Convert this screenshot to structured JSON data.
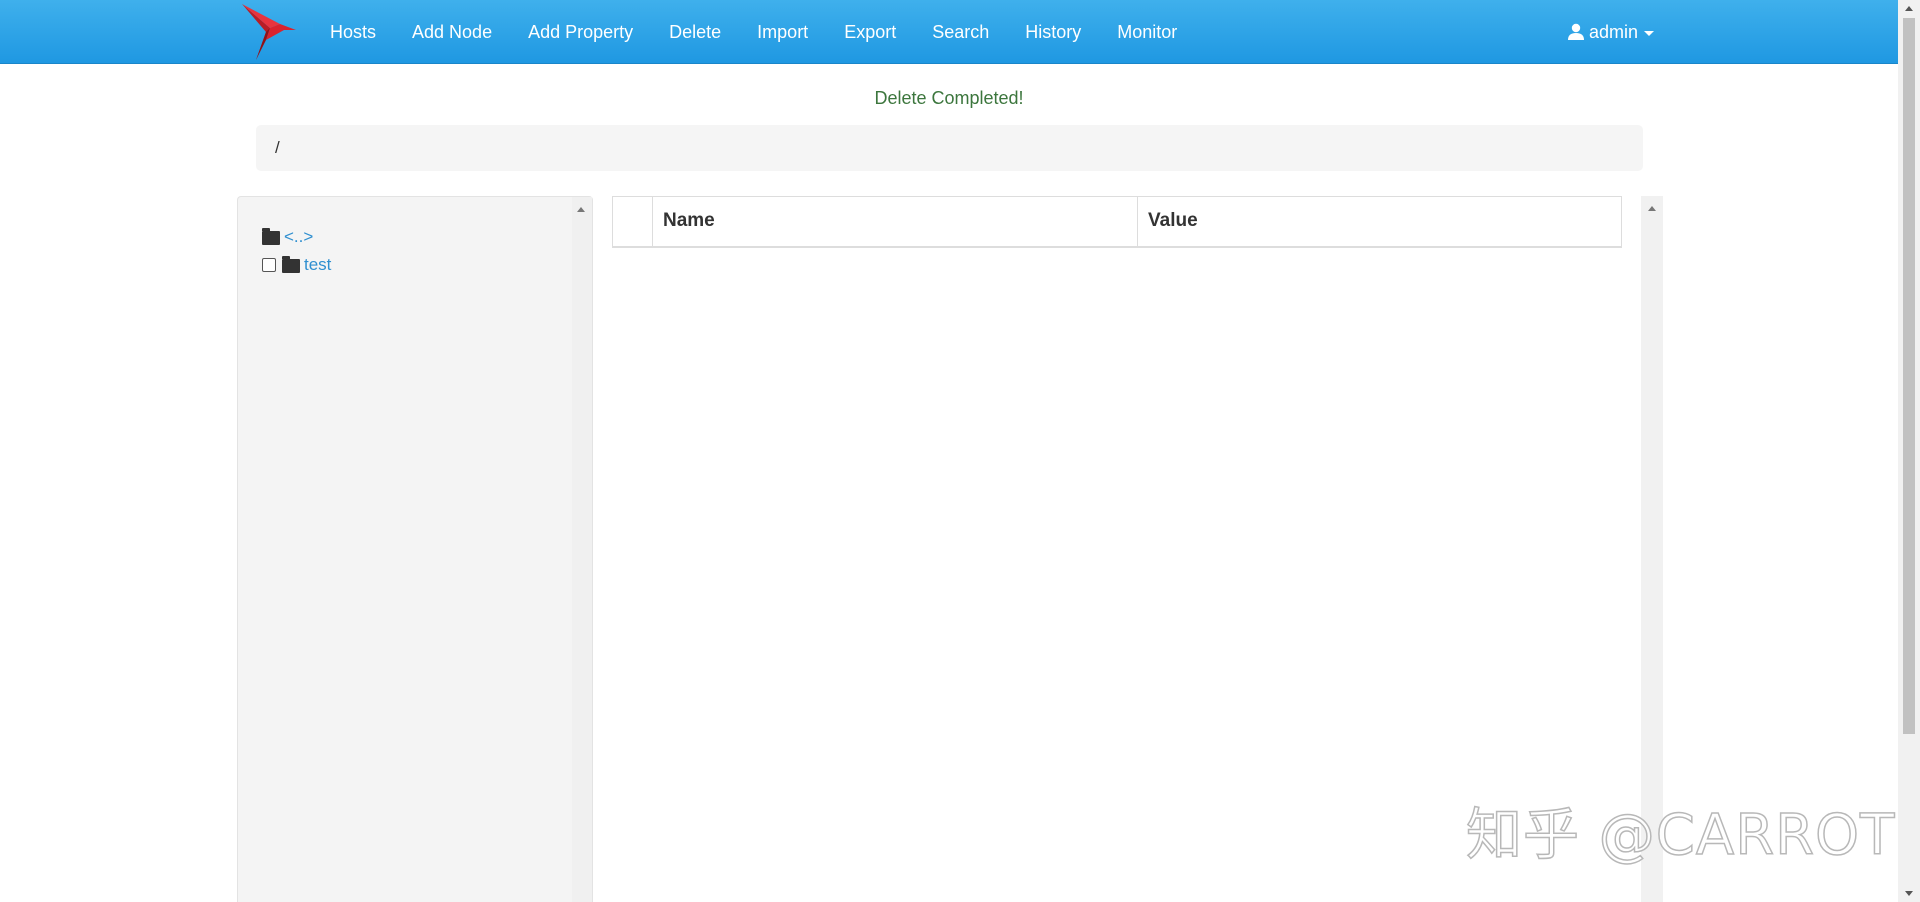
{
  "nav": {
    "logo_icon": "hummingbird-logo",
    "items": [
      {
        "label": "Hosts"
      },
      {
        "label": "Add Node"
      },
      {
        "label": "Add Property"
      },
      {
        "label": "Delete"
      },
      {
        "label": "Import"
      },
      {
        "label": "Export"
      },
      {
        "label": "Search"
      },
      {
        "label": "History"
      },
      {
        "label": "Monitor"
      }
    ],
    "user": {
      "label": "admin",
      "icon": "user-icon"
    },
    "colors": {
      "bar": "#2aa3e8",
      "logo": "#d9232e"
    }
  },
  "alert": {
    "message": "Delete Completed!",
    "color": "#3c763d"
  },
  "breadcrumb": {
    "path": "/"
  },
  "tree": {
    "parent": {
      "label": "<..>",
      "icon": "folder-icon"
    },
    "nodes": [
      {
        "label": "test",
        "icon": "folder-icon",
        "checked": false
      }
    ]
  },
  "table": {
    "columns": {
      "name": "Name",
      "value": "Value"
    }
  },
  "watermark": {
    "text": "知乎 @CARROT"
  }
}
